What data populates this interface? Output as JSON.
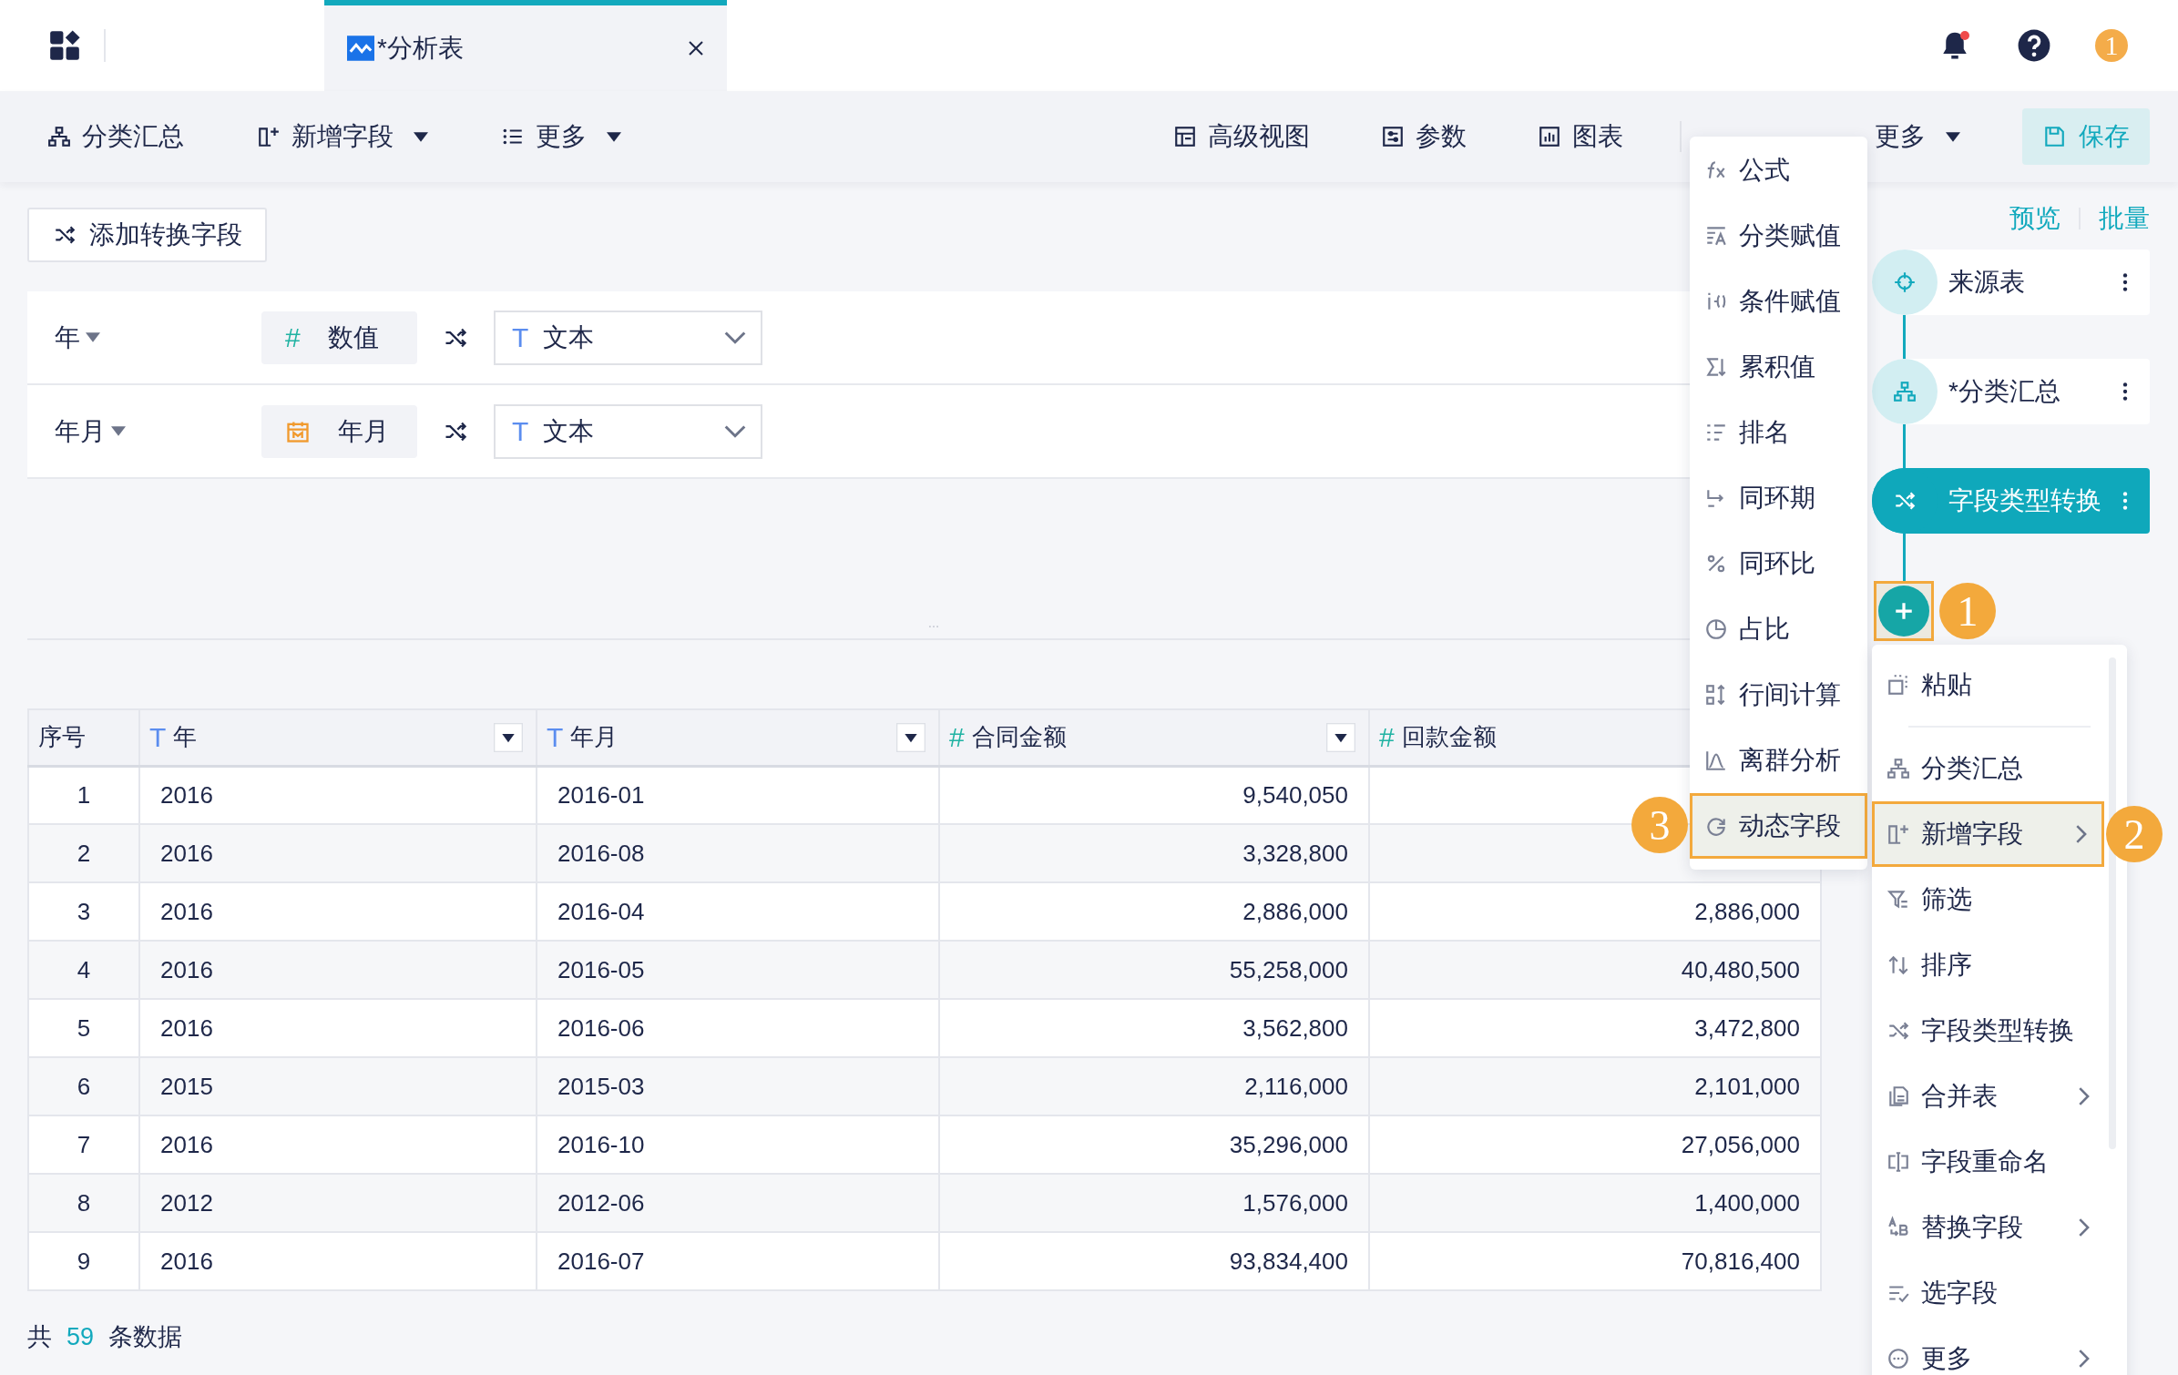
{
  "topbar": {
    "tab": {
      "title": "*分析表",
      "selected": true
    },
    "notifications": {
      "unread": true
    },
    "user_badge": "1"
  },
  "toolbar": {
    "left": [
      {
        "label": "分类汇总",
        "dropdown": false
      },
      {
        "label": "新增字段",
        "dropdown": true
      },
      {
        "label": "更多",
        "dropdown": true
      }
    ],
    "right": [
      {
        "kind": "button",
        "label": "高级视图"
      },
      {
        "kind": "button",
        "label": "参数"
      },
      {
        "kind": "button",
        "label": "图表"
      },
      {
        "kind": "separator"
      },
      {
        "kind": "dropdown",
        "label": "更多"
      },
      {
        "kind": "primary",
        "label": "保存"
      }
    ]
  },
  "convert_button": "添加转换字段",
  "conversions": [
    {
      "field": "年",
      "source": {
        "kind": "number",
        "mark": "#",
        "label": "数值"
      },
      "target": {
        "mark": "T",
        "label": "文本"
      }
    },
    {
      "field": "年月",
      "source": {
        "kind": "date",
        "label": "年月"
      },
      "target": {
        "mark": "T",
        "label": "文本"
      }
    }
  ],
  "table": {
    "columns": [
      {
        "label": "序号",
        "kind": "index"
      },
      {
        "label": "年",
        "kind": "text",
        "mark": "T",
        "filter": true
      },
      {
        "label": "年月",
        "kind": "text",
        "mark": "T",
        "filter": true
      },
      {
        "label": "合同金额",
        "kind": "number",
        "mark": "#",
        "filter": true
      },
      {
        "label": "回款金额",
        "kind": "number",
        "mark": "#"
      }
    ],
    "rows": [
      [
        "1",
        "2016",
        "2016-01",
        "9,540,050",
        null
      ],
      [
        "2",
        "2016",
        "2016-08",
        "3,328,800",
        null
      ],
      [
        "3",
        "2016",
        "2016-04",
        "2,886,000",
        "2,886,000"
      ],
      [
        "4",
        "2016",
        "2016-05",
        "55,258,000",
        "40,480,500"
      ],
      [
        "5",
        "2016",
        "2016-06",
        "3,562,800",
        "3,472,800"
      ],
      [
        "6",
        "2015",
        "2015-03",
        "2,116,000",
        "2,101,000"
      ],
      [
        "7",
        "2016",
        "2016-10",
        "35,296,000",
        "27,056,000"
      ],
      [
        "8",
        "2012",
        "2012-06",
        "1,576,000",
        "1,400,000"
      ],
      [
        "9",
        "2016",
        "2016-07",
        "93,834,400",
        "70,816,400"
      ]
    ]
  },
  "footer": {
    "prefix": "共",
    "count": "59",
    "suffix": "条数据"
  },
  "flow": {
    "links": [
      "预览",
      "批量"
    ],
    "nodes": [
      {
        "label": "来源表",
        "kind": "source",
        "selected": false
      },
      {
        "label": "*分类汇总",
        "kind": "group",
        "selected": false
      },
      {
        "label": "字段类型转换",
        "kind": "convert",
        "selected": true
      }
    ],
    "add_button": {
      "callout": "1"
    }
  },
  "submenu": {
    "items": [
      {
        "label": "公式",
        "selected": false
      },
      {
        "label": "分类赋值",
        "selected": false
      },
      {
        "label": "条件赋值",
        "selected": false
      },
      {
        "label": "累积值",
        "selected": false
      },
      {
        "label": "排名",
        "selected": false
      },
      {
        "label": "同环期",
        "selected": false
      },
      {
        "label": "同环比",
        "selected": false
      },
      {
        "label": "占比",
        "selected": false
      },
      {
        "label": "行间计算",
        "selected": false
      },
      {
        "label": "离群分析",
        "selected": false
      },
      {
        "label": "动态字段",
        "selected": true,
        "callout": "3"
      }
    ]
  },
  "context_menu": {
    "items": [
      {
        "kind": "item",
        "label": "粘贴",
        "selected": false,
        "submenu": false
      },
      {
        "kind": "divider"
      },
      {
        "kind": "item",
        "label": "分类汇总",
        "selected": false,
        "submenu": false
      },
      {
        "kind": "item",
        "label": "新增字段",
        "selected": true,
        "submenu": true,
        "callout": "2"
      },
      {
        "kind": "item",
        "label": "筛选",
        "selected": false,
        "submenu": false
      },
      {
        "kind": "item",
        "label": "排序",
        "selected": false,
        "submenu": false
      },
      {
        "kind": "item",
        "label": "字段类型转换",
        "selected": false,
        "submenu": false
      },
      {
        "kind": "item",
        "label": "合并表",
        "selected": false,
        "submenu": true
      },
      {
        "kind": "item",
        "label": "字段重命名",
        "selected": false,
        "submenu": false
      },
      {
        "kind": "item",
        "label": "替换字段",
        "selected": false,
        "submenu": true
      },
      {
        "kind": "item",
        "label": "选字段",
        "selected": false,
        "submenu": false
      },
      {
        "kind": "item",
        "label": "更多",
        "selected": false,
        "submenu": true
      }
    ]
  }
}
